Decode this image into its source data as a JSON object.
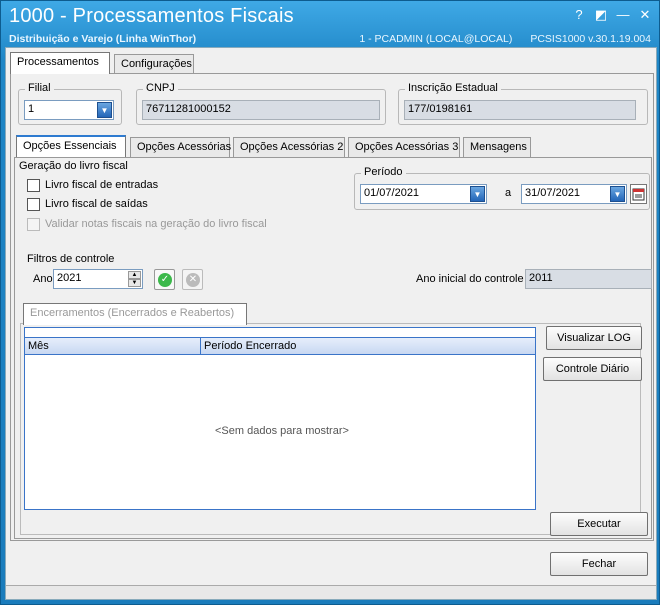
{
  "window": {
    "title": "1000 - Processamentos Fiscais",
    "subtitle": "Distribuição e Varejo (Linha WinThor)",
    "user": "1 - PCADMIN (LOCAL@LOCAL)",
    "version": "PCSIS1000  v.30.1.19.004",
    "help_glyph": "?",
    "restore_glyph": "◩",
    "minimize_glyph": "—",
    "maximize_glyph": "☐",
    "close_glyph": "✕"
  },
  "top_tabs": [
    {
      "label": "Processamentos"
    },
    {
      "label": "Configurações"
    }
  ],
  "header": {
    "filial_label": "Filial",
    "filial_value": "1",
    "cnpj_label": "CNPJ",
    "cnpj_value": "76711281000152",
    "ie_label": "Inscrição Estadual",
    "ie_value": "177/0198161"
  },
  "sub_tabs": [
    {
      "label": "Opções Essenciais"
    },
    {
      "label": "Opções Acessórias"
    },
    {
      "label": "Opções Acessórias 2"
    },
    {
      "label": "Opções Acessórias 3"
    },
    {
      "label": "Mensagens"
    }
  ],
  "geracao": {
    "title": "Geração do livro fiscal",
    "entradas": "Livro fiscal de entradas",
    "saidas": "Livro fiscal de saídas",
    "validar": "Validar notas fiscais na geração do livro fiscal"
  },
  "periodo": {
    "title": "Período",
    "start": "01/07/2021",
    "sep": "a",
    "end": "31/07/2021"
  },
  "filtros": {
    "title": "Filtros de controle",
    "ano_label": "Ano",
    "ano_value": "2021",
    "ano_inicial_label": "Ano inicial do controle",
    "ano_inicial_value": "2011"
  },
  "encerramentos": {
    "tab_label": "Encerramentos (Encerrados e Reabertos)",
    "col_mes": "Mês",
    "col_periodo": "Período Encerrado",
    "empty": "<Sem dados para mostrar>"
  },
  "buttons": {
    "visualizar_log": "Visualizar LOG",
    "controle_diario": "Controle Diário",
    "executar": "Executar",
    "fechar": "Fechar"
  }
}
